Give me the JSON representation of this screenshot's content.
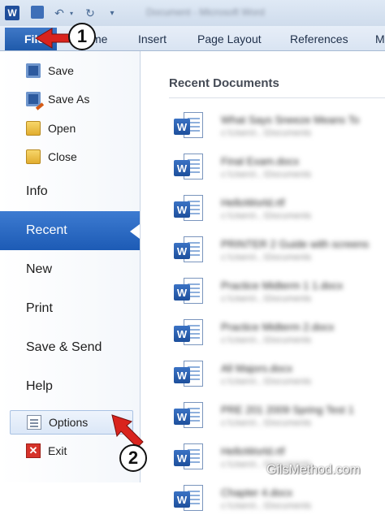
{
  "titlebar": {
    "app_icon_letter": "W",
    "window_title": "Document - Microsoft Word"
  },
  "ribbon": {
    "tabs": [
      {
        "id": "file",
        "label": "File"
      },
      {
        "id": "home",
        "label": "me"
      },
      {
        "id": "insert",
        "label": "Insert"
      },
      {
        "id": "page_layout",
        "label": "Page Layout"
      },
      {
        "id": "references",
        "label": "References"
      },
      {
        "id": "mailings",
        "label": "M"
      }
    ]
  },
  "backstage": {
    "commands": {
      "save": "Save",
      "save_as": "Save As",
      "open": "Open",
      "close": "Close",
      "info": "Info",
      "recent": "Recent",
      "new": "New",
      "print": "Print",
      "save_send": "Save & Send",
      "help": "Help",
      "options": "Options",
      "exit": "Exit"
    },
    "selected": "Recent",
    "accent_color": "#2a66bd"
  },
  "recent": {
    "heading": "Recent Documents",
    "documents": [
      {
        "name": "What Says Sneeze Means To",
        "path": "c:\\Users\\...\\Documents"
      },
      {
        "name": "Final Exam.docx",
        "path": "c:\\Users\\...\\Documents"
      },
      {
        "name": "HelloWorld.rtf",
        "path": "c:\\Users\\...\\Documents"
      },
      {
        "name": "PRINTER 2 Guide with screens",
        "path": "c:\\Users\\...\\Documents"
      },
      {
        "name": "Practice Midterm 1 1.docx",
        "path": "c:\\Users\\...\\Documents"
      },
      {
        "name": "Practice Midterm 2.docx",
        "path": "c:\\Users\\...\\Documents"
      },
      {
        "name": "All Majors.docx",
        "path": "c:\\Users\\...\\Documents"
      },
      {
        "name": "PRE 201 2009 Spring Test 1",
        "path": "c:\\Users\\...\\Documents"
      },
      {
        "name": "HelloWorld.rtf",
        "path": "c:\\Users\\...\\Documents"
      },
      {
        "name": "Chapter 4.docx",
        "path": "c:\\Users\\...\\Documents"
      }
    ]
  },
  "annotations": {
    "marker_1": "1",
    "marker_2": "2",
    "arrow_color": "#d9231d"
  },
  "watermark": "GilsMethod.com"
}
